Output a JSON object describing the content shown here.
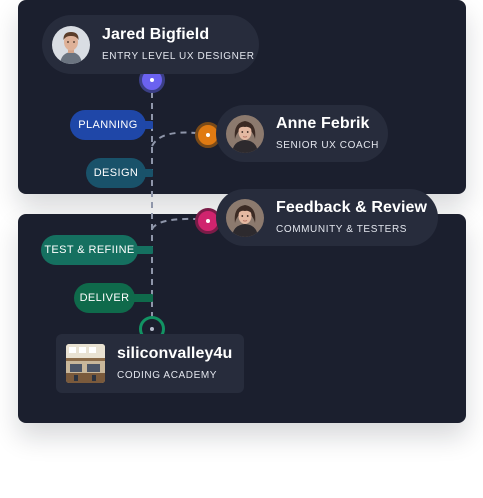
{
  "nodes": {
    "jared": {
      "name": "Jared Bigfield",
      "role": "ENTRY LEVEL UX DESIGNER"
    },
    "anne": {
      "name": "Anne Febrik",
      "role": "SENIOR UX COACH"
    },
    "feedback": {
      "name": "Feedback & Review",
      "role": "COMMUNITY & TESTERS"
    },
    "academy": {
      "name": "siliconvalley4u",
      "role": "CODING ACADEMY"
    }
  },
  "steps": [
    {
      "label": "PLANNING",
      "color": "#1f47a8"
    },
    {
      "label": "DESIGN",
      "color": "#19526a"
    },
    {
      "label": "TEST & REFIINE",
      "color": "#157060"
    },
    {
      "label": "DELIVER",
      "color": "#0f6a4b"
    }
  ],
  "colors": {
    "panel": "#1b1f2e",
    "card": "#272c3c",
    "start_dot": "#6b62f0",
    "coach_dot": "#e07a12",
    "feedback_dot": "#d0246e",
    "end_dot": "#129363",
    "timeline": "#8f96aa"
  },
  "icons": {
    "avatar_jared": "person-avatar",
    "avatar_anne": "person-avatar",
    "avatar_feedback": "person-avatar",
    "logo_academy": "office-photo"
  }
}
